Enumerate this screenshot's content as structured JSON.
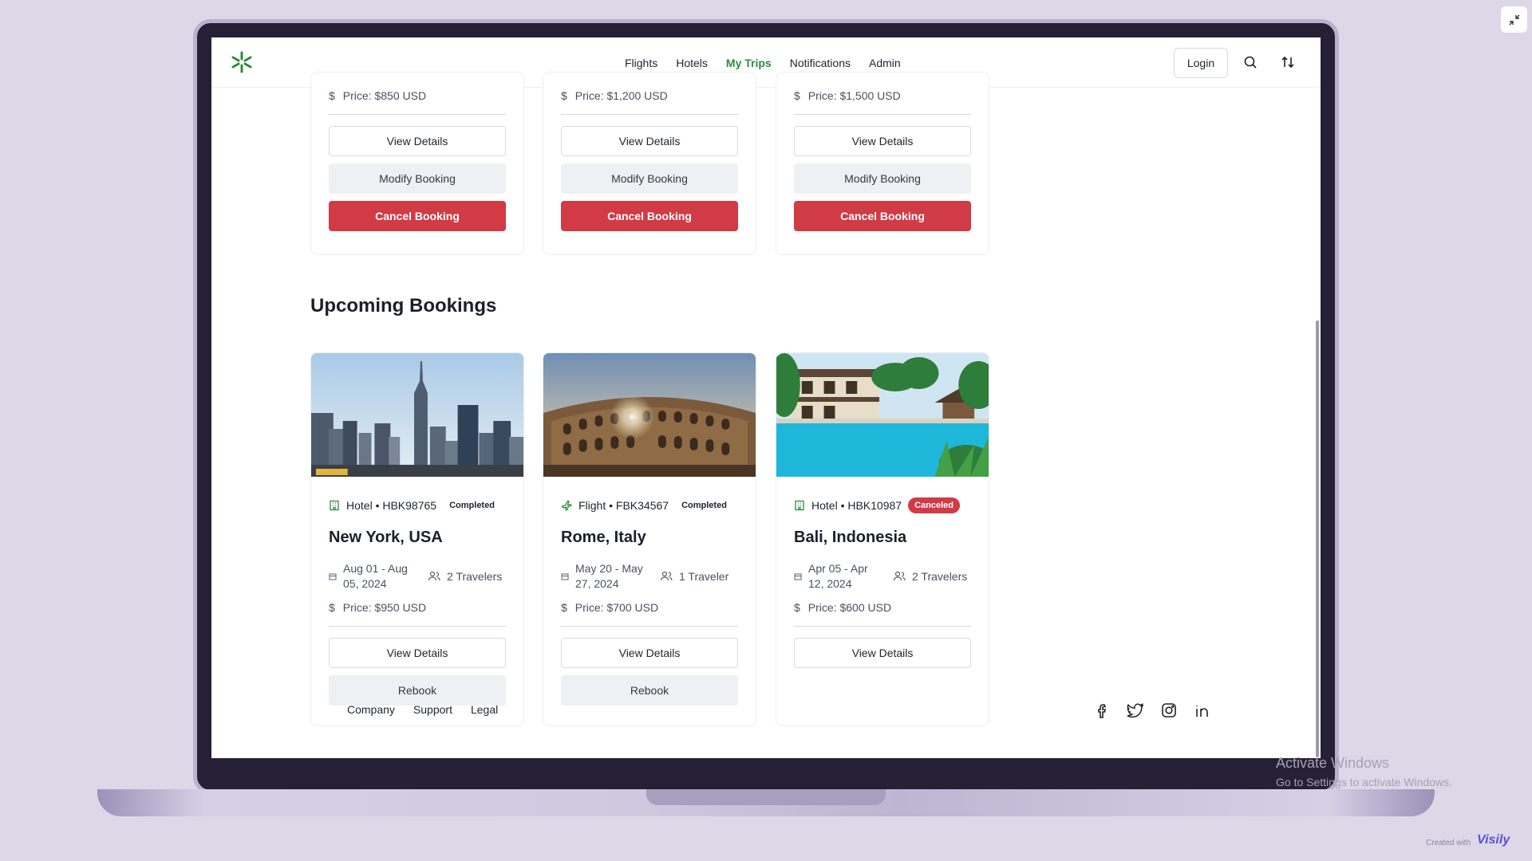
{
  "nav": {
    "links": [
      {
        "label": "Flights"
      },
      {
        "label": "Hotels"
      },
      {
        "label": "My Trips"
      },
      {
        "label": "Notifications"
      },
      {
        "label": "Admin"
      }
    ],
    "login_label": "Login"
  },
  "top_cards": [
    {
      "price": "Price: $850 USD",
      "view": "View Details",
      "modify": "Modify Booking",
      "cancel": "Cancel Booking"
    },
    {
      "price": "Price: $1,200 USD",
      "view": "View Details",
      "modify": "Modify Booking",
      "cancel": "Cancel Booking"
    },
    {
      "price": "Price: $1,500 USD",
      "view": "View Details",
      "modify": "Modify Booking",
      "cancel": "Cancel Booking"
    }
  ],
  "section_title": "Upcoming Bookings",
  "bookings": [
    {
      "type_ref": "Hotel • HBK98765",
      "status": "Completed",
      "destination": "New York, USA",
      "dates": "Aug 01 - Aug 05, 2024",
      "travelers": "2 Travelers",
      "price": "Price: $950 USD",
      "view": "View Details",
      "rebook": "Rebook",
      "icon": "hotel-icon"
    },
    {
      "type_ref": "Flight • FBK34567",
      "status": "Completed",
      "destination": "Rome, Italy",
      "dates": "May 20 - May 27, 2024",
      "travelers": "1 Traveler",
      "price": "Price: $700 USD",
      "view": "View Details",
      "rebook": "Rebook",
      "icon": "flight-icon"
    },
    {
      "type_ref": "Hotel • HBK10987",
      "status": "Canceled",
      "destination": "Bali, Indonesia",
      "dates": "Apr 05 - Apr 12, 2024",
      "travelers": "2 Travelers",
      "price": "Price: $600 USD",
      "view": "View Details",
      "icon": "hotel-icon"
    }
  ],
  "footer": {
    "links": [
      "Company",
      "Support",
      "Legal"
    ],
    "social": [
      "facebook-icon",
      "twitter-icon",
      "instagram-icon",
      "linkedin-icon"
    ]
  },
  "watermark": {
    "title": "Activate Windows",
    "subtitle": "Go to Settings to activate Windows."
  },
  "created_with": "Created with",
  "brand": "Visily",
  "colors": {
    "accent_green": "#2f8a3d",
    "danger_red": "#d03b46"
  }
}
